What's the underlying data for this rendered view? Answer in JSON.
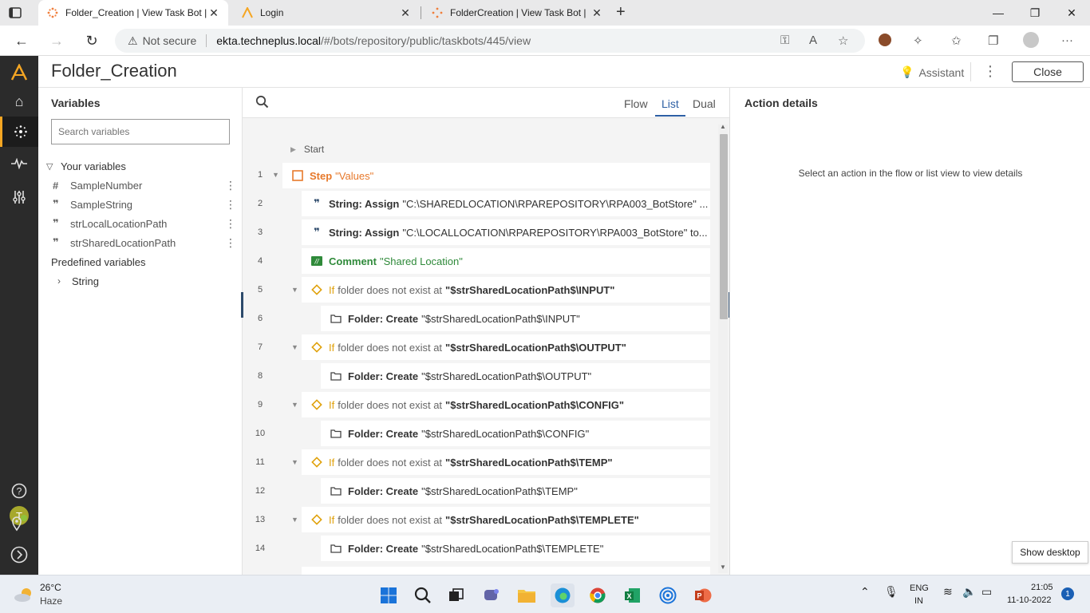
{
  "browser": {
    "tabs": [
      {
        "title": "Folder_Creation | View Task Bot |",
        "active": true
      },
      {
        "title": "Login",
        "active": false
      },
      {
        "title": "FolderCreation | View Task Bot |",
        "active": false
      }
    ],
    "new_tab": "+",
    "window": {
      "minimize": "—",
      "maximize": "❐",
      "close": "✕"
    },
    "address": {
      "security_label": "Not secure",
      "host": "ekta.techneplus.local",
      "path": "/#/bots/repository/public/taskbots/445/view"
    }
  },
  "app": {
    "bot_title": "Folder_Creation",
    "assistant_label": "Assistant",
    "close_label": "Close",
    "rail_avatar": "T",
    "accent": "#f5a623"
  },
  "variables": {
    "title": "Variables",
    "search_placeholder": "Search variables",
    "your_variables_label": "Your variables",
    "items": [
      {
        "icon": "#",
        "name": "SampleNumber"
      },
      {
        "icon": "❞",
        "name": "SampleString"
      },
      {
        "icon": "❞",
        "name": "strLocalLocationPath"
      },
      {
        "icon": "❞",
        "name": "strSharedLocationPath"
      }
    ],
    "predefined_label": "Predefined variables",
    "predefined_items": [
      "String"
    ]
  },
  "editor": {
    "views": [
      "Flow",
      "List",
      "Dual"
    ],
    "active_view": "List",
    "start_label": "Start",
    "lines": [
      {
        "no": "1",
        "type": "step",
        "kw": "Step",
        "val": "\"Values\""
      },
      {
        "no": "2",
        "type": "string",
        "kw": "String: Assign",
        "val": "\"C:\\SHAREDLOCATION\\RPAREPOSITORY\\RPA003_BotStore\" ..."
      },
      {
        "no": "3",
        "type": "string",
        "kw": "String: Assign",
        "val": "\"C:\\LOCALLOCATION\\RPAREPOSITORY\\RPA003_BotStore\" to..."
      },
      {
        "no": "4",
        "type": "comment",
        "kw": "Comment",
        "val": "\"Shared Location\""
      },
      {
        "no": "5",
        "type": "if",
        "kw": "If",
        "txt": "folder does not exist at",
        "val": "\"$strSharedLocationPath$\\INPUT\""
      },
      {
        "no": "6",
        "type": "folder",
        "kw": "Folder: Create",
        "val": "\"$strSharedLocationPath$\\INPUT\""
      },
      {
        "no": "7",
        "type": "if",
        "kw": "If",
        "txt": "folder does not exist at",
        "val": "\"$strSharedLocationPath$\\OUTPUT\""
      },
      {
        "no": "8",
        "type": "folder",
        "kw": "Folder: Create",
        "val": "\"$strSharedLocationPath$\\OUTPUT\""
      },
      {
        "no": "9",
        "type": "if",
        "kw": "If",
        "txt": "folder does not exist at",
        "val": "\"$strSharedLocationPath$\\CONFIG\""
      },
      {
        "no": "10",
        "type": "folder",
        "kw": "Folder: Create",
        "val": "\"$strSharedLocationPath$\\CONFIG\""
      },
      {
        "no": "11",
        "type": "if",
        "kw": "If",
        "txt": "folder does not exist at",
        "val": "\"$strSharedLocationPath$\\TEMP\""
      },
      {
        "no": "12",
        "type": "folder",
        "kw": "Folder: Create",
        "val": "\"$strSharedLocationPath$\\TEMP\""
      },
      {
        "no": "13",
        "type": "if",
        "kw": "If",
        "txt": "folder does not exist at",
        "val": "\"$strSharedLocationPath$\\TEMPLETE\""
      },
      {
        "no": "14",
        "type": "folder",
        "kw": "Folder: Create",
        "val": "\"$strSharedLocationPath$\\TEMPLETE\""
      }
    ]
  },
  "details": {
    "title": "Action details",
    "empty_message": "Select an action in the flow or list view to view details"
  },
  "desktop": {
    "show_desktop_tooltip": "Show desktop"
  },
  "taskbar": {
    "weather_temp": "26°C",
    "weather_cond": "Haze",
    "lang_line1": "ENG",
    "lang_line2": "IN",
    "time": "21:05",
    "date": "11-10-2022",
    "notification_count": "1"
  }
}
